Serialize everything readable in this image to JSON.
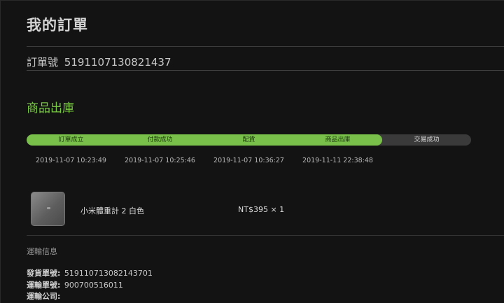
{
  "page": {
    "title": "我的訂單"
  },
  "order": {
    "number_label": "訂單號",
    "number": "5191107130821437"
  },
  "status": {
    "heading": "商品出庫"
  },
  "progress": {
    "completed_steps": 4,
    "total_steps": 5,
    "steps": [
      {
        "label": "訂單成立",
        "time": "2019-11-07 10:23:49"
      },
      {
        "label": "付款成功",
        "time": "2019-11-07 10:25:46"
      },
      {
        "label": "配貨",
        "time": "2019-11-07 10:36:27"
      },
      {
        "label": "商品出庫",
        "time": "2019-11-11 22:38:48"
      },
      {
        "label": "交易成功",
        "time": ""
      }
    ]
  },
  "product": {
    "name": "小米體重計 2 白色",
    "price": "NT$395 × 1"
  },
  "shipping": {
    "heading": "運輸信息",
    "rows": [
      {
        "label": "發貨單號:",
        "value": "519110713082143701"
      },
      {
        "label": "運輸單號:",
        "value": "900700516011"
      },
      {
        "label": "運輸公司:",
        "value": ""
      }
    ]
  },
  "colors": {
    "accent": "#79c04a",
    "background": "#131313"
  }
}
